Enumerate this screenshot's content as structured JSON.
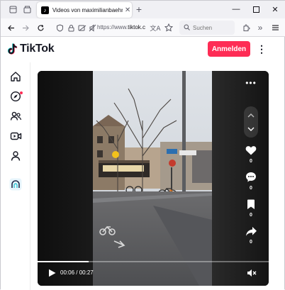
{
  "browser": {
    "tab": {
      "title": "Videos von maximilianbaehring"
    },
    "address": {
      "prefix": "https://www.",
      "domain": "tiktok.c"
    },
    "search": {
      "placeholder": "Suchen"
    }
  },
  "header": {
    "logo_text": "TikTok",
    "login_label": "Anmelden"
  },
  "video": {
    "time_current": "00:06",
    "time_separator": " / ",
    "time_total": "00:27",
    "progress_fraction": 0.22,
    "counts": {
      "likes": "0",
      "comments": "0",
      "saves": "0",
      "shares": "0"
    }
  },
  "colors": {
    "brand": "#fe2c55",
    "text": "#161823"
  }
}
